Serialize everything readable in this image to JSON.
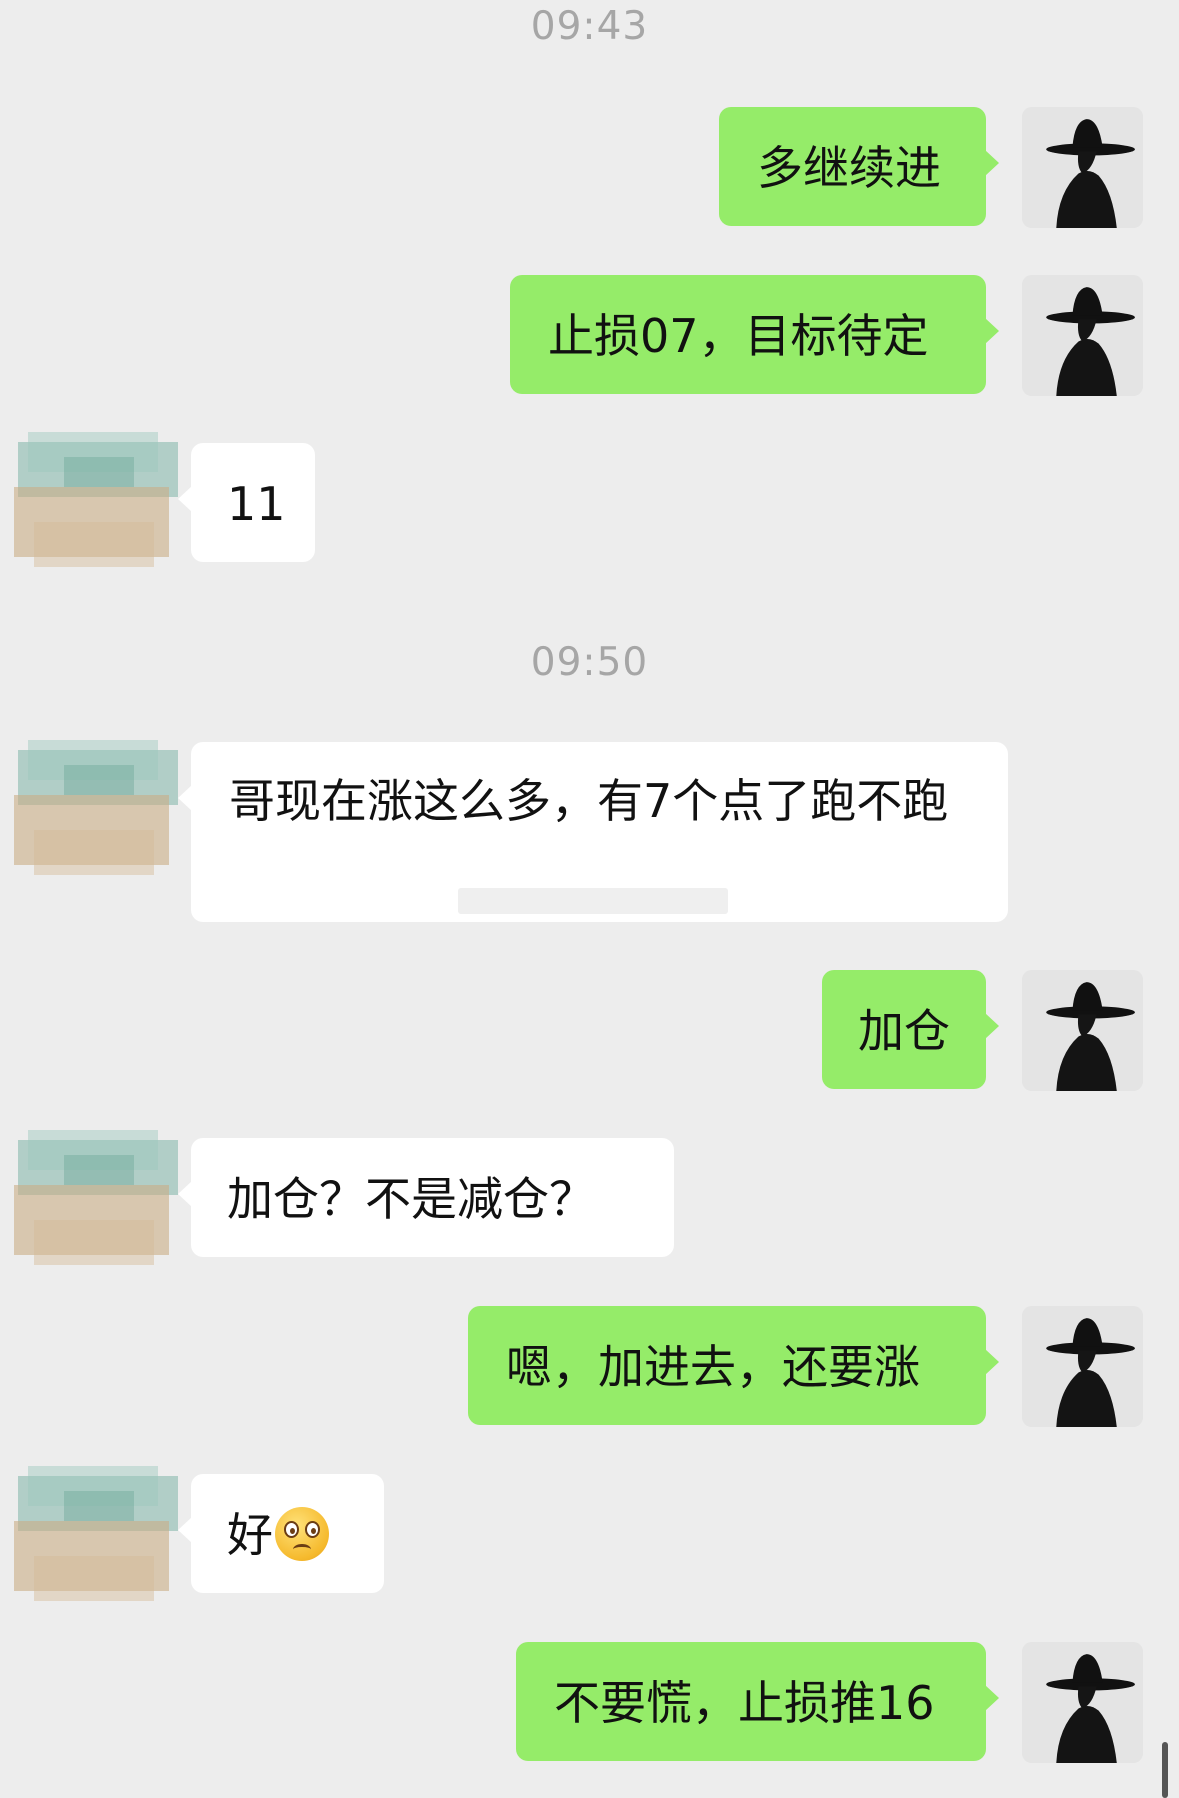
{
  "timestamps": [
    "09:43",
    "09:50"
  ],
  "messages": [
    {
      "side": "out",
      "text": "多继续进"
    },
    {
      "side": "out",
      "text": "止损07，目标待定"
    },
    {
      "side": "in",
      "text": "11"
    },
    {
      "side": "in",
      "text": "哥现在涨这么多，有7个点了跑不跑"
    },
    {
      "side": "out",
      "text": "加仓"
    },
    {
      "side": "in",
      "text": "加仓？不是减仓？"
    },
    {
      "side": "out",
      "text": "嗯，加进去，还要涨"
    },
    {
      "side": "in",
      "text": "好",
      "emoji": "woozy-face-emoji"
    },
    {
      "side": "out",
      "text": "不要慌，止损推16"
    }
  ],
  "colors": {
    "background": "#ededed",
    "outgoing_bubble": "#95ec69",
    "incoming_bubble": "#ffffff",
    "timestamp": "#a6a6a6"
  },
  "icons": {
    "my_avatar": "hat-silhouette-avatar",
    "contact_avatar": "blurred-paint-avatar"
  }
}
